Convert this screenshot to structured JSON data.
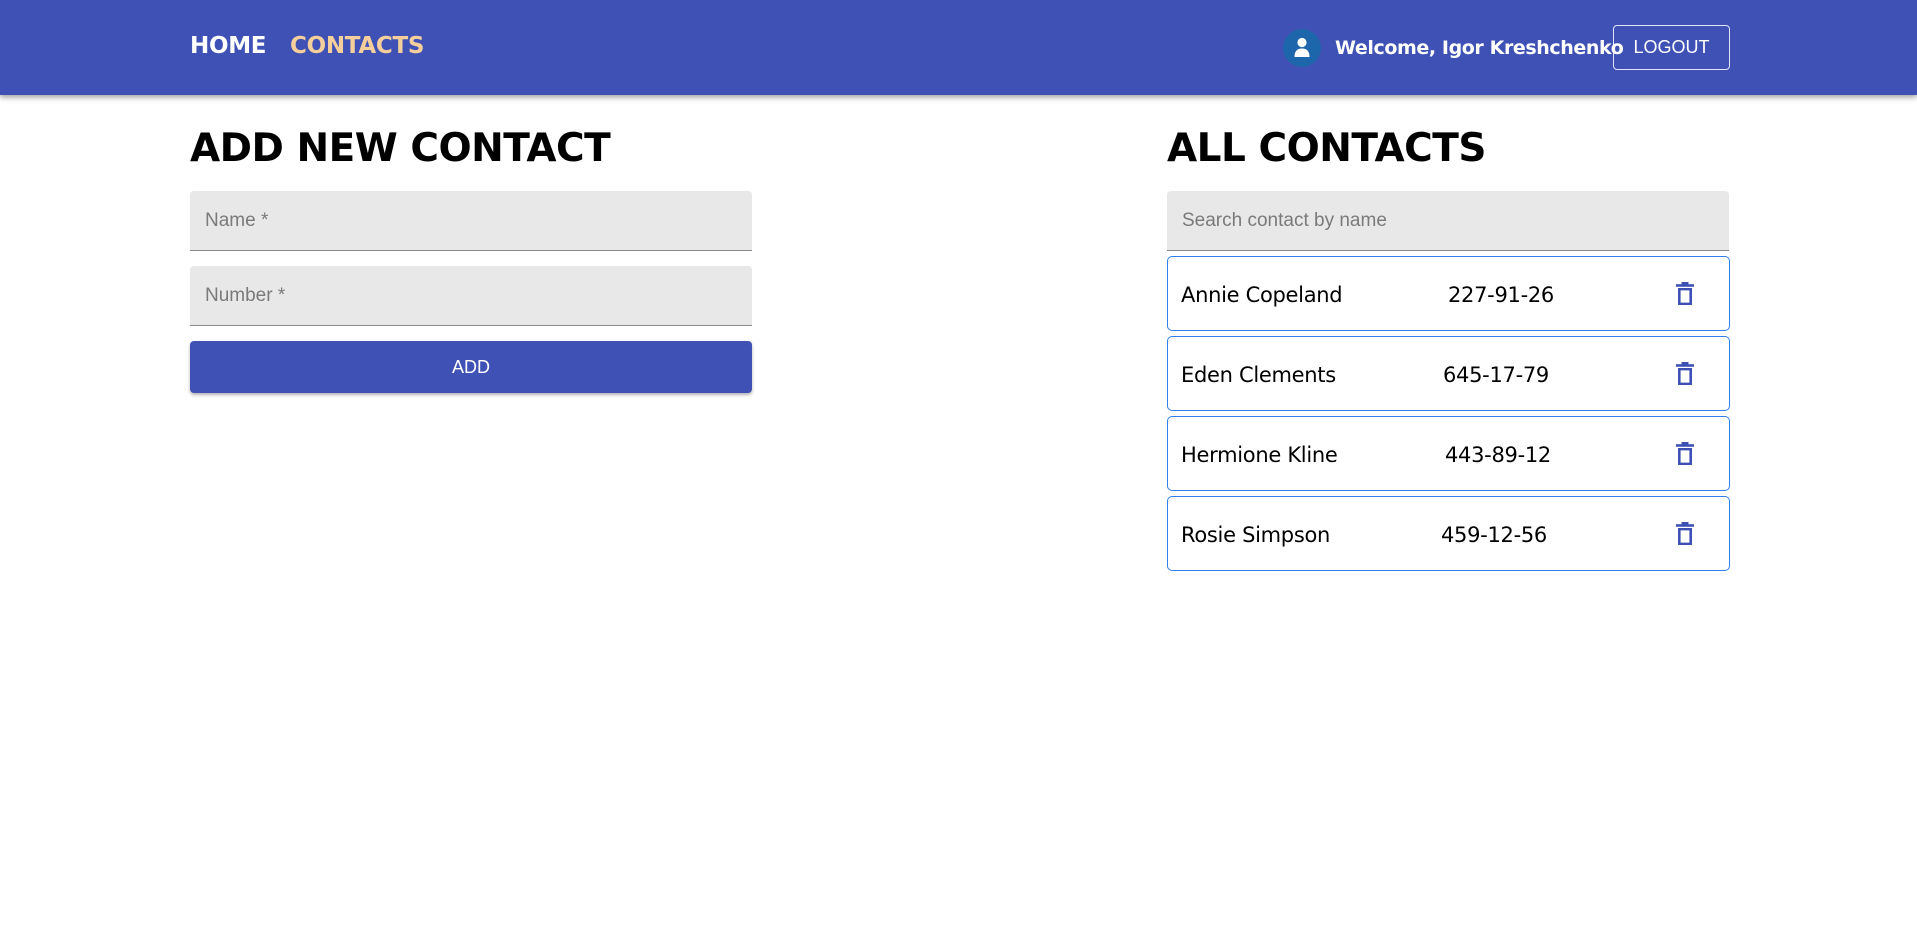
{
  "header": {
    "nav": [
      {
        "label": "HOME"
      },
      {
        "label": "CONTACTS"
      }
    ],
    "welcome_text": "Welcome, Igor Kreshchenko",
    "logout_label": "LOGOUT",
    "avatar_icon": "user-avatar-icon",
    "colors": {
      "bar": "#3f51b5",
      "active_nav": "#f4cf9c"
    }
  },
  "add_contact": {
    "title": "ADD NEW CONTACT",
    "name_placeholder": "Name *",
    "number_placeholder": "Number *",
    "add_label": "ADD"
  },
  "all_contacts": {
    "title": "ALL CONTACTS",
    "search_placeholder": "Search contact by name",
    "delete_icon": "trash-icon",
    "items": [
      {
        "name": "Annie Copeland",
        "number": "227-91-26"
      },
      {
        "name": "Eden Clements",
        "number": "645-17-79"
      },
      {
        "name": "Hermione Kline",
        "number": "443-89-12"
      },
      {
        "name": "Rosie Simpson",
        "number": "459-12-56"
      }
    ]
  }
}
